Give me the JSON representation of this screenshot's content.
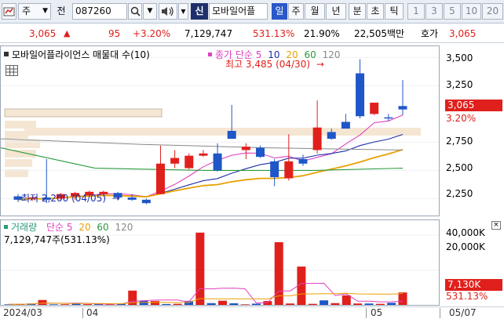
{
  "toolbar": {
    "market": "주",
    "prev_label": "전",
    "code": "087260",
    "stock_name": "모바일어플",
    "shin": "신",
    "periods": [
      "일",
      "주",
      "월",
      "년",
      "분",
      "초",
      "틱"
    ],
    "active_period": "일",
    "numbers": [
      "1",
      "3",
      "5",
      "10",
      "20"
    ]
  },
  "quote": {
    "price": "3,065",
    "change": "95",
    "change_pct": "+3.20%",
    "volume": "7,129,747",
    "volume_ratio": "531.13%",
    "turnover": "21.90%",
    "amount": "22,505백만",
    "ask_label": "호가",
    "ask_price": "3,065"
  },
  "price_panel": {
    "legend_name": "모바일어플라이언스 매물대 수(10)",
    "legend_ma": "종가 단순 5",
    "legend_ma_periods": [
      "10",
      "20",
      "60",
      "120"
    ],
    "high_label": "최고 3,485 (04/30)",
    "low_label": "최저 2,200 (04/05)",
    "y_ticks": [
      "3,500",
      "3,250",
      "3,000",
      "2,750",
      "2,500",
      "2,250"
    ],
    "current_price_tag": "3,065",
    "current_pct_tag": "3.20%"
  },
  "volume_panel": {
    "legend_name": "거래량",
    "legend_ma": "단순 5",
    "legend_ma_periods": [
      "20",
      "60",
      "120"
    ],
    "volume_text": "7,129,747주(531.13%)",
    "y_ticks": [
      "40,000K",
      "20,000K"
    ],
    "current_tag": "7,130K",
    "current_pct_tag": "531.13%"
  },
  "x_axis": {
    "labels": [
      "2024/03",
      "04",
      "05",
      "05/07"
    ]
  },
  "colors": {
    "up": "#e0201c",
    "down": "#1f56c8",
    "ma5": "#e040c0",
    "ma10": "#1f2fa8",
    "ma20": "#e8a000",
    "ma60": "#2a9a3a",
    "ma120": "#888888"
  },
  "chart_data": {
    "type": "candlestick",
    "ylim": [
      2100,
      3600
    ],
    "candles": [
      {
        "o": 2270,
        "h": 2290,
        "l": 2220,
        "c": 2240
      },
      {
        "o": 2250,
        "h": 2270,
        "l": 2230,
        "c": 2260
      },
      {
        "o": 2260,
        "h": 2600,
        "l": 2210,
        "c": 2240
      },
      {
        "o": 2250,
        "h": 2300,
        "l": 2240,
        "c": 2290
      },
      {
        "o": 2270,
        "h": 2310,
        "l": 2240,
        "c": 2300
      },
      {
        "o": 2280,
        "h": 2320,
        "l": 2260,
        "c": 2310
      },
      {
        "o": 2290,
        "h": 2320,
        "l": 2270,
        "c": 2310
      },
      {
        "o": 2300,
        "h": 2310,
        "l": 2240,
        "c": 2260
      },
      {
        "o": 2260,
        "h": 2290,
        "l": 2230,
        "c": 2240
      },
      {
        "o": 2240,
        "h": 2250,
        "l": 2200,
        "c": 2210
      },
      {
        "o": 2290,
        "h": 2720,
        "l": 2290,
        "c": 2560
      },
      {
        "o": 2560,
        "h": 2680,
        "l": 2520,
        "c": 2610
      },
      {
        "o": 2520,
        "h": 2650,
        "l": 2510,
        "c": 2630
      },
      {
        "o": 2630,
        "h": 2680,
        "l": 2620,
        "c": 2650
      },
      {
        "o": 2650,
        "h": 2740,
        "l": 2490,
        "c": 2500
      },
      {
        "o": 2850,
        "h": 3080,
        "l": 2780,
        "c": 2780
      },
      {
        "o": 2680,
        "h": 2740,
        "l": 2600,
        "c": 2710
      },
      {
        "o": 2700,
        "h": 2720,
        "l": 2610,
        "c": 2620
      },
      {
        "o": 2580,
        "h": 2600,
        "l": 2360,
        "c": 2440
      },
      {
        "o": 2430,
        "h": 2820,
        "l": 2410,
        "c": 2580
      },
      {
        "o": 2600,
        "h": 2640,
        "l": 2540,
        "c": 2560
      },
      {
        "o": 2680,
        "h": 3120,
        "l": 2650,
        "c": 2880
      },
      {
        "o": 2840,
        "h": 2870,
        "l": 2770,
        "c": 2780
      },
      {
        "o": 2930,
        "h": 3000,
        "l": 2880,
        "c": 2870
      },
      {
        "o": 3360,
        "h": 3485,
        "l": 2960,
        "c": 2980
      },
      {
        "o": 3000,
        "h": 3010,
        "l": 2990,
        "c": 3100
      },
      {
        "o": 2970,
        "h": 3000,
        "l": 2940,
        "c": 2960
      },
      {
        "o": 3070,
        "h": 3300,
        "l": 2990,
        "c": 3040
      }
    ],
    "volume_ylim": [
      0,
      45000
    ],
    "volumes": [
      300,
      450,
      800,
      2800,
      300,
      350,
      700,
      400,
      700,
      250,
      600,
      8200,
      2500,
      2200,
      500,
      600,
      2300,
      41500,
      1000,
      2400,
      900,
      300,
      700,
      2200,
      36000,
      800,
      22000,
      600,
      2600,
      1000,
      5500,
      800,
      800,
      600,
      1200,
      7130
    ]
  }
}
